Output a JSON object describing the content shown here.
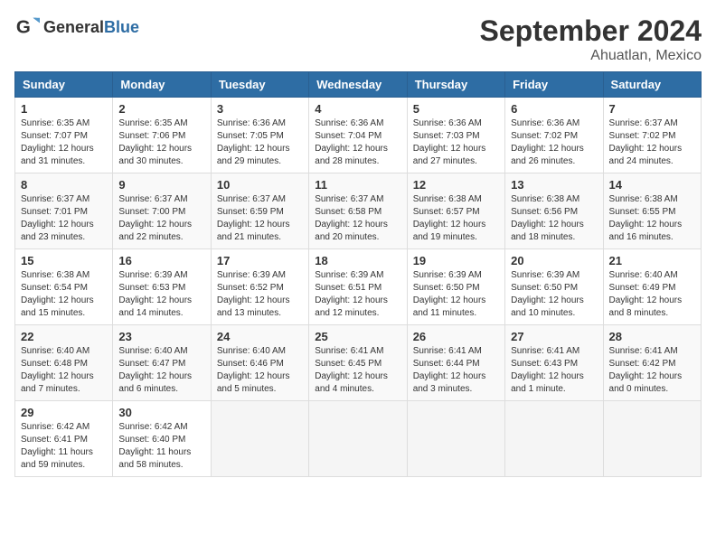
{
  "header": {
    "logo_general": "General",
    "logo_blue": "Blue",
    "month_title": "September 2024",
    "location": "Ahuatlan, Mexico"
  },
  "days_of_week": [
    "Sunday",
    "Monday",
    "Tuesday",
    "Wednesday",
    "Thursday",
    "Friday",
    "Saturday"
  ],
  "weeks": [
    [
      {
        "day": "1",
        "info": "Sunrise: 6:35 AM\nSunset: 7:07 PM\nDaylight: 12 hours\nand 31 minutes."
      },
      {
        "day": "2",
        "info": "Sunrise: 6:35 AM\nSunset: 7:06 PM\nDaylight: 12 hours\nand 30 minutes."
      },
      {
        "day": "3",
        "info": "Sunrise: 6:36 AM\nSunset: 7:05 PM\nDaylight: 12 hours\nand 29 minutes."
      },
      {
        "day": "4",
        "info": "Sunrise: 6:36 AM\nSunset: 7:04 PM\nDaylight: 12 hours\nand 28 minutes."
      },
      {
        "day": "5",
        "info": "Sunrise: 6:36 AM\nSunset: 7:03 PM\nDaylight: 12 hours\nand 27 minutes."
      },
      {
        "day": "6",
        "info": "Sunrise: 6:36 AM\nSunset: 7:02 PM\nDaylight: 12 hours\nand 26 minutes."
      },
      {
        "day": "7",
        "info": "Sunrise: 6:37 AM\nSunset: 7:02 PM\nDaylight: 12 hours\nand 24 minutes."
      }
    ],
    [
      {
        "day": "8",
        "info": "Sunrise: 6:37 AM\nSunset: 7:01 PM\nDaylight: 12 hours\nand 23 minutes."
      },
      {
        "day": "9",
        "info": "Sunrise: 6:37 AM\nSunset: 7:00 PM\nDaylight: 12 hours\nand 22 minutes."
      },
      {
        "day": "10",
        "info": "Sunrise: 6:37 AM\nSunset: 6:59 PM\nDaylight: 12 hours\nand 21 minutes."
      },
      {
        "day": "11",
        "info": "Sunrise: 6:37 AM\nSunset: 6:58 PM\nDaylight: 12 hours\nand 20 minutes."
      },
      {
        "day": "12",
        "info": "Sunrise: 6:38 AM\nSunset: 6:57 PM\nDaylight: 12 hours\nand 19 minutes."
      },
      {
        "day": "13",
        "info": "Sunrise: 6:38 AM\nSunset: 6:56 PM\nDaylight: 12 hours\nand 18 minutes."
      },
      {
        "day": "14",
        "info": "Sunrise: 6:38 AM\nSunset: 6:55 PM\nDaylight: 12 hours\nand 16 minutes."
      }
    ],
    [
      {
        "day": "15",
        "info": "Sunrise: 6:38 AM\nSunset: 6:54 PM\nDaylight: 12 hours\nand 15 minutes."
      },
      {
        "day": "16",
        "info": "Sunrise: 6:39 AM\nSunset: 6:53 PM\nDaylight: 12 hours\nand 14 minutes."
      },
      {
        "day": "17",
        "info": "Sunrise: 6:39 AM\nSunset: 6:52 PM\nDaylight: 12 hours\nand 13 minutes."
      },
      {
        "day": "18",
        "info": "Sunrise: 6:39 AM\nSunset: 6:51 PM\nDaylight: 12 hours\nand 12 minutes."
      },
      {
        "day": "19",
        "info": "Sunrise: 6:39 AM\nSunset: 6:50 PM\nDaylight: 12 hours\nand 11 minutes."
      },
      {
        "day": "20",
        "info": "Sunrise: 6:39 AM\nSunset: 6:50 PM\nDaylight: 12 hours\nand 10 minutes."
      },
      {
        "day": "21",
        "info": "Sunrise: 6:40 AM\nSunset: 6:49 PM\nDaylight: 12 hours\nand 8 minutes."
      }
    ],
    [
      {
        "day": "22",
        "info": "Sunrise: 6:40 AM\nSunset: 6:48 PM\nDaylight: 12 hours\nand 7 minutes."
      },
      {
        "day": "23",
        "info": "Sunrise: 6:40 AM\nSunset: 6:47 PM\nDaylight: 12 hours\nand 6 minutes."
      },
      {
        "day": "24",
        "info": "Sunrise: 6:40 AM\nSunset: 6:46 PM\nDaylight: 12 hours\nand 5 minutes."
      },
      {
        "day": "25",
        "info": "Sunrise: 6:41 AM\nSunset: 6:45 PM\nDaylight: 12 hours\nand 4 minutes."
      },
      {
        "day": "26",
        "info": "Sunrise: 6:41 AM\nSunset: 6:44 PM\nDaylight: 12 hours\nand 3 minutes."
      },
      {
        "day": "27",
        "info": "Sunrise: 6:41 AM\nSunset: 6:43 PM\nDaylight: 12 hours\nand 1 minute."
      },
      {
        "day": "28",
        "info": "Sunrise: 6:41 AM\nSunset: 6:42 PM\nDaylight: 12 hours\nand 0 minutes."
      }
    ],
    [
      {
        "day": "29",
        "info": "Sunrise: 6:42 AM\nSunset: 6:41 PM\nDaylight: 11 hours\nand 59 minutes."
      },
      {
        "day": "30",
        "info": "Sunrise: 6:42 AM\nSunset: 6:40 PM\nDaylight: 11 hours\nand 58 minutes."
      },
      {
        "day": "",
        "info": ""
      },
      {
        "day": "",
        "info": ""
      },
      {
        "day": "",
        "info": ""
      },
      {
        "day": "",
        "info": ""
      },
      {
        "day": "",
        "info": ""
      }
    ]
  ]
}
